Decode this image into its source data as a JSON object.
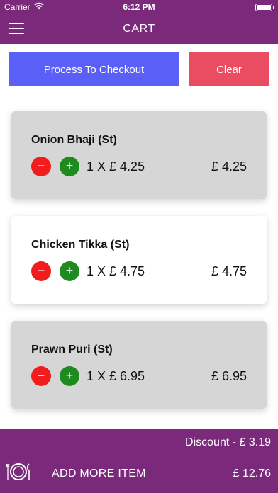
{
  "status_bar": {
    "carrier": "Carrier",
    "wifi_icon": "wifi-icon",
    "time": "6:12 PM",
    "battery_level": 1.0
  },
  "header": {
    "menu_icon": "hamburger-menu-icon",
    "title": "CART"
  },
  "actions": {
    "checkout_label": "Process To Checkout",
    "clear_label": "Clear",
    "checkout_color": "#5a5ff8",
    "clear_color": "#ea4c62"
  },
  "cart": {
    "items": [
      {
        "name": "Onion Bhaji (St)",
        "minus": "−",
        "plus": "+",
        "quantity_line": "1 X  £ 4.25",
        "total": "£ 4.25"
      },
      {
        "name": "Chicken Tikka (St)",
        "minus": "−",
        "plus": "+",
        "quantity_line": "1 X  £ 4.75",
        "total": "£ 4.75"
      },
      {
        "name": "Prawn Puri (St)",
        "minus": "−",
        "plus": "+",
        "quantity_line": "1 X  £ 6.95",
        "total": "£ 6.95"
      }
    ]
  },
  "footer": {
    "discount": "Discount - £ 3.19",
    "plate_icon": "plate-cutlery-icon",
    "add_more_label": "ADD MORE ITEM",
    "grand_total": "£ 12.76"
  },
  "colors": {
    "brand": "#7b2a7b",
    "minus_button": "#f21c1c",
    "plus_button": "#1f8a1f"
  }
}
